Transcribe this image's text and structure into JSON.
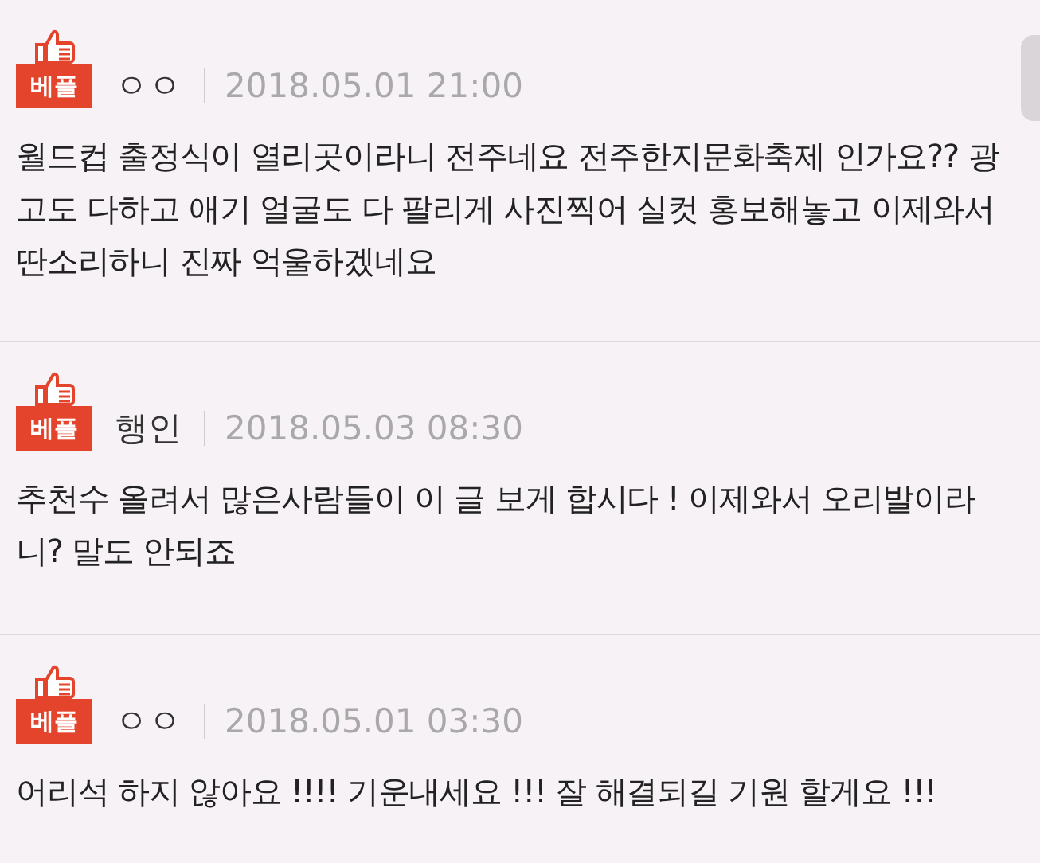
{
  "comments": [
    {
      "badge": "베플",
      "author": "ㅇㅇ",
      "date": "2018.05.01 21:00",
      "text": "월드컵 출정식이 열리곳이라니 전주네요 전주한지문화축제 인가요?? 광고도 다하고 애기 얼굴도 다 팔리게 사진찍어 실컷 홍보해놓고 이제와서 딴소리하니 진짜 억울하겠네요"
    },
    {
      "badge": "베플",
      "author": "행인",
      "date": "2018.05.03 08:30",
      "text": "추천수 올려서 많은사람들이 이 글 보게 합시다 ! 이제와서 오리발이라니? 말도 안되죠"
    },
    {
      "badge": "베플",
      "author": "ㅇㅇ",
      "date": "2018.05.01 03:30",
      "text": "어리석 하지 않아요 !!!! 기운내세요 !!! 잘 해결되길 기원 할게요 !!!"
    }
  ]
}
